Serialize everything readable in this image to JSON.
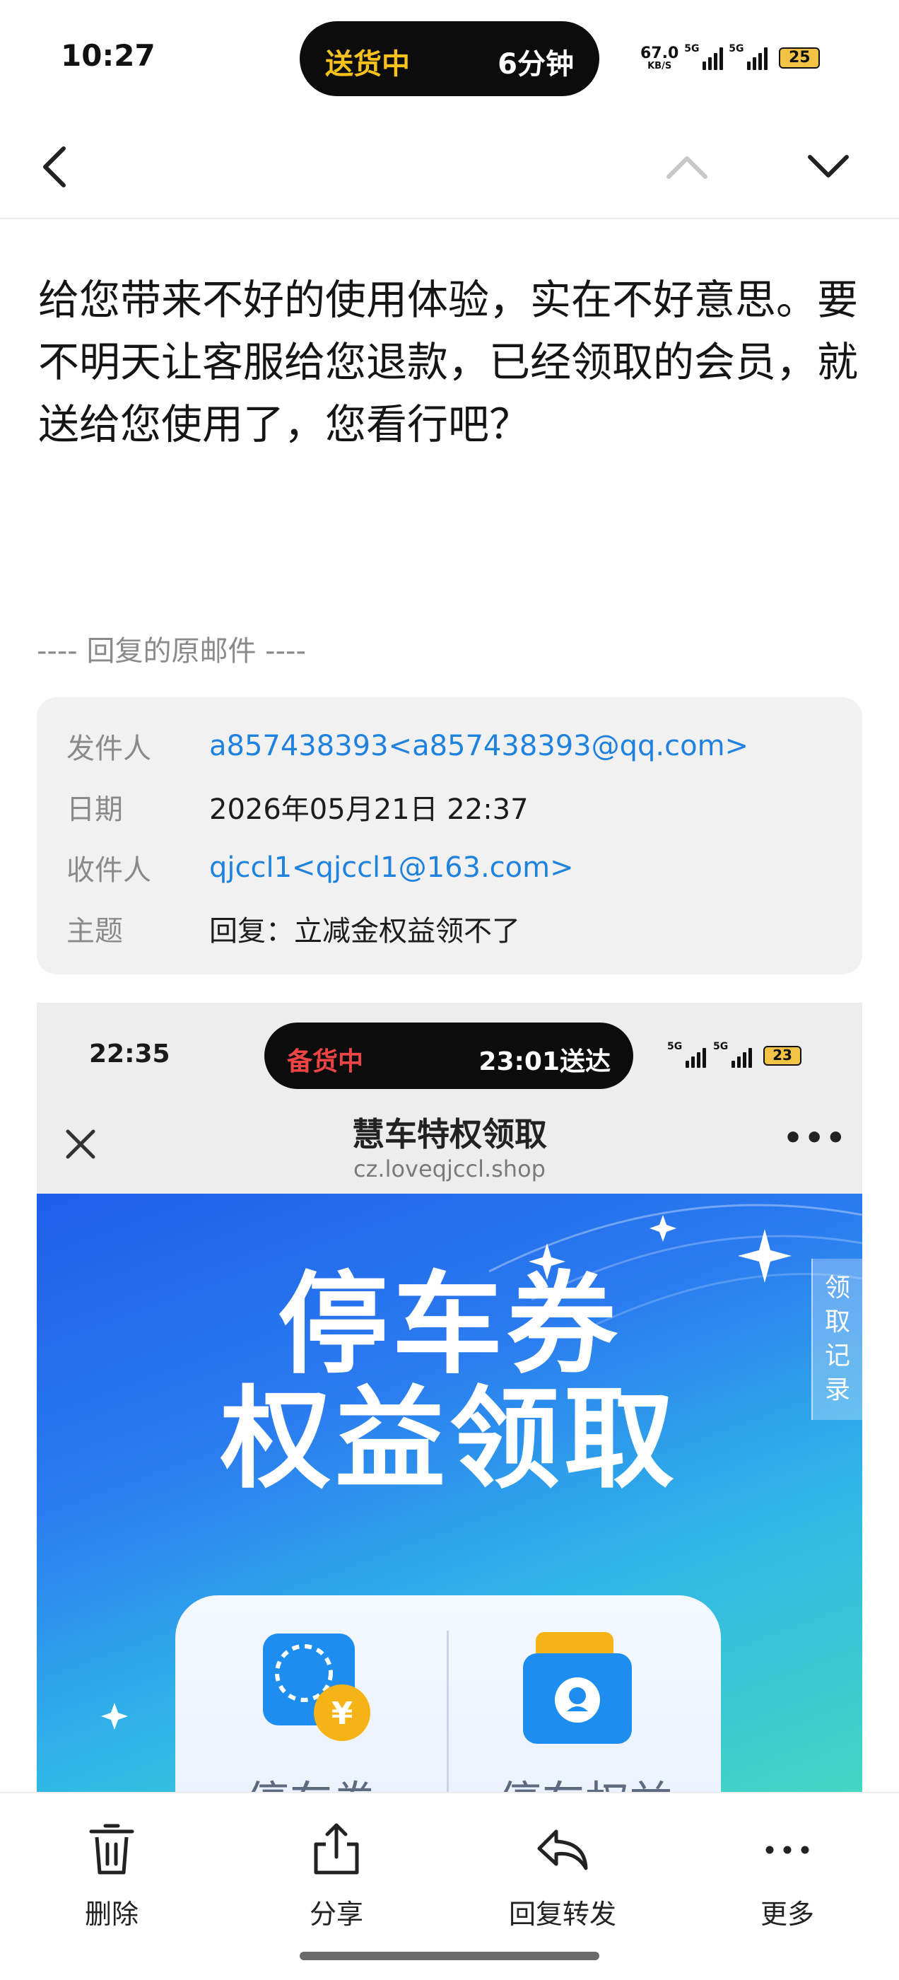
{
  "status_bar": {
    "time": "10:27",
    "island_left": "送货中",
    "island_right": "6分钟",
    "net_speed_value": "67.0",
    "net_speed_unit": "KB/S",
    "signal1": "5G",
    "signal2": "5G",
    "battery": "25"
  },
  "nav": {
    "back_icon": "chevron-left-icon",
    "prev_icon": "chevron-up-icon",
    "next_icon": "chevron-down-icon"
  },
  "message": {
    "body": "给您带来不好的使用体验，实在不好意思。要不明天让客服给您退款，已经领取的会员，就送给您使用了，您看行吧？",
    "original_divider": "---- 回复的原邮件 ----"
  },
  "original_mail": {
    "sender_label": "发件人",
    "sender_value": "a857438393<a857438393@qq.com>",
    "date_label": "日期",
    "date_value": "2026年05月21日 22:37",
    "recipient_label": "收件人",
    "recipient_value": "qjccl1<qjccl1@163.com>",
    "subject_label": "主题",
    "subject_value": "回复：立减金权益领不了"
  },
  "embedded_screenshot": {
    "time": "22:35",
    "island_left": "备货中",
    "island_right": "23:01送达",
    "signal1": "5G",
    "signal2": "5G",
    "battery": "23",
    "page_title": "慧车特权领取",
    "page_url": "cz.loveqjccl.shop",
    "more_label": "•••",
    "banner_line1": "停车券",
    "banner_line2": "权益领取",
    "side_tab": [
      "领",
      "取",
      "记",
      "录"
    ],
    "tile1_label": "停车券",
    "tile2_label": "停车权益",
    "colors": {
      "banner_start": "#1e5fe8",
      "banner_end": "#43d6c2",
      "coin": "#f5b316"
    }
  },
  "toolbar": {
    "delete_label": "删除",
    "share_label": "分享",
    "reply_label": "回复转发",
    "more_label": "更多"
  }
}
